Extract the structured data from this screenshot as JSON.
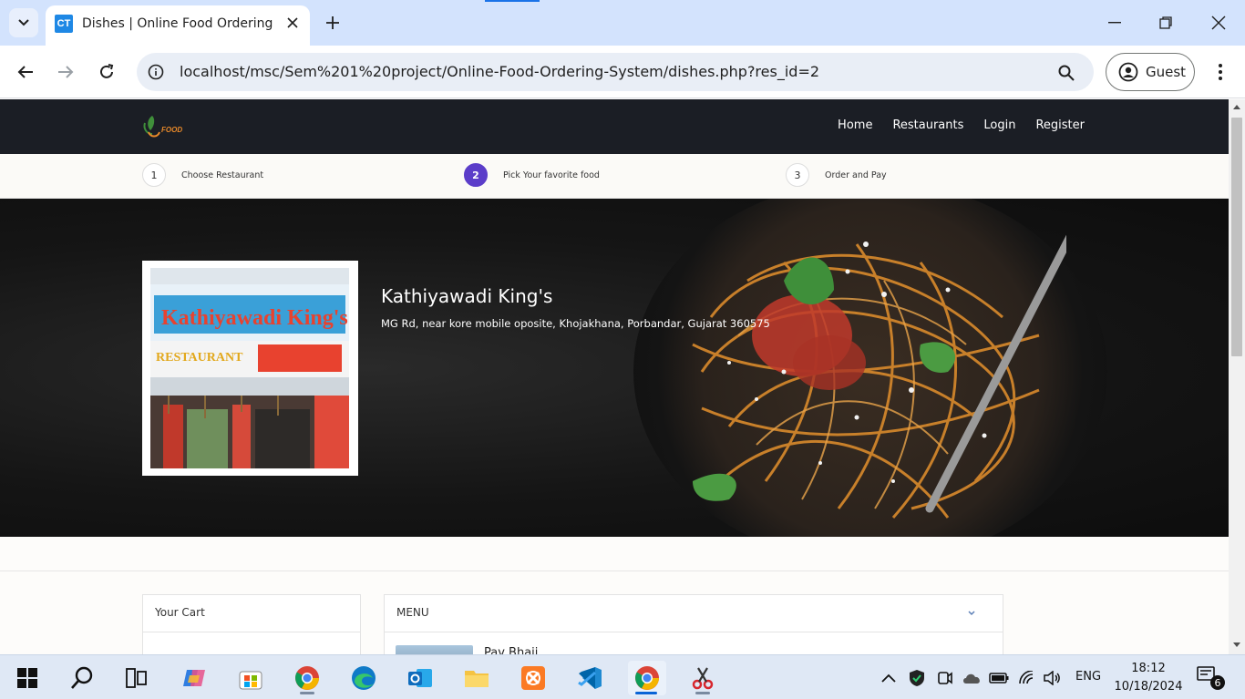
{
  "browser": {
    "tab_title": "Dishes | Online Food Ordering S",
    "tab_favicon_text": "CT",
    "url": "localhost/msc/Sem%201%20project/Online-Food-Ordering-System/dishes.php?res_id=2",
    "profile_label": "Guest"
  },
  "site": {
    "logo_text": "FOOD",
    "nav": [
      "Home",
      "Restaurants",
      "Login",
      "Register"
    ]
  },
  "steps": [
    {
      "num": "1",
      "label": "Choose Restaurant",
      "active": false
    },
    {
      "num": "2",
      "label": "Pick Your favorite food",
      "active": true
    },
    {
      "num": "3",
      "label": "Order and Pay",
      "active": false
    }
  ],
  "restaurant": {
    "name": "Kathiyawadi King's",
    "address": "MG Rd, near kore mobile oposite, Khojakhana, Porbandar, Gujarat 360575",
    "photo_sign_text": "Kathiyawadi King's",
    "photo_sign_sub": "RESTAURANT"
  },
  "cart": {
    "title": "Your Cart"
  },
  "menu": {
    "title": "MENU",
    "first_dish": "Pav Bhaji"
  },
  "taskbar": {
    "lang": "ENG",
    "time": "18:12",
    "date": "10/18/2024",
    "notification_count": "6"
  },
  "colors": {
    "step_active": "#5b3dc9",
    "site_nav_bg": "#1b1e25",
    "tabbar_bg": "#d3e3fd"
  }
}
